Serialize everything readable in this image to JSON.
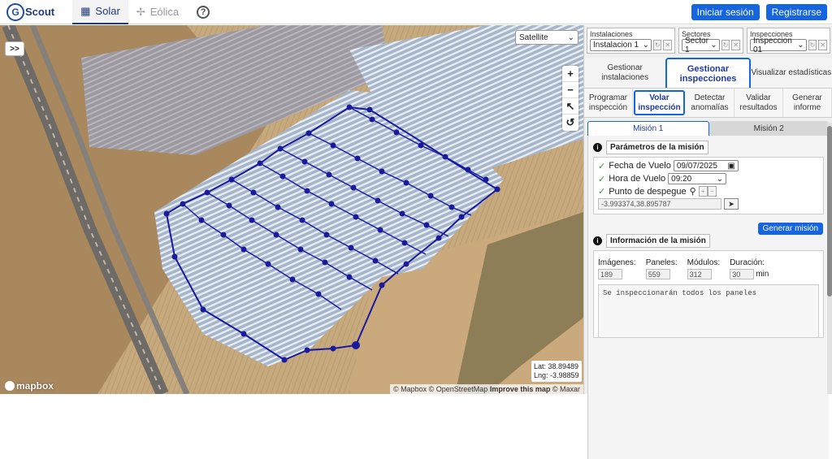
{
  "topbar": {
    "logo_letter": "G",
    "logo_text": "Scout",
    "tabs": [
      {
        "label": "Solar",
        "icon": "solar-panel-icon"
      },
      {
        "label": "Eólica",
        "icon": "wind-turbine-icon"
      }
    ],
    "help_icon": "help-icon",
    "login_label": "Iniciar sesión",
    "register_label": "Registrarse"
  },
  "map": {
    "expand_label": ">>",
    "layer_select": "Satellite",
    "zoom_in": "+",
    "zoom_out": "−",
    "compass": "↖",
    "reset": "↺",
    "lat_label": "Lat: 38.89489",
    "lng_label": "Lng: -3.98859",
    "attribution_prefix": "© Mapbox © OpenStreetMap",
    "attribution_link": "Improve this map",
    "attribution_suffix": "© Maxar",
    "brand": "mapbox"
  },
  "panel": {
    "selectors": [
      {
        "label": "Instalaciones",
        "value": "Instalacion 1"
      },
      {
        "label": "Sectores",
        "value": "Sector 1"
      },
      {
        "label": "Inspecciones",
        "value": "Inspeccion 01"
      }
    ],
    "main_tabs": [
      {
        "label": "Gestionar instalaciones"
      },
      {
        "label": "Gestionar inspecciones"
      },
      {
        "label": "Visualizar estadísticas"
      }
    ],
    "sub_tabs": [
      {
        "label": "Programar inspección"
      },
      {
        "label": "Volar inspección"
      },
      {
        "label": "Detectar anomalías"
      },
      {
        "label": "Validar resultados"
      },
      {
        "label": "Generar informe"
      }
    ],
    "mission_tabs": [
      "Misión 1",
      "Misión 2"
    ],
    "params": {
      "title": "Parámetros de la misión",
      "date_label": "Fecha de Vuelo",
      "date_value": "09/07/2025",
      "time_label": "Hora de Vuelo",
      "time_value": "09:20",
      "takeoff_label": "Punto de despegue",
      "takeoff_coords": "-3.993374,38.895787",
      "generate_label": "Generar misión"
    },
    "info": {
      "title": "Información de la misión",
      "images_label": "Imágenes:",
      "images_value": "189",
      "panels_label": "Paneles:",
      "panels_value": "559",
      "modules_label": "Módulos:",
      "modules_value": "312",
      "duration_label": "Duración:",
      "duration_value": "30",
      "duration_unit": "min",
      "note": "Se inspeccionarán todos los paneles"
    }
  }
}
